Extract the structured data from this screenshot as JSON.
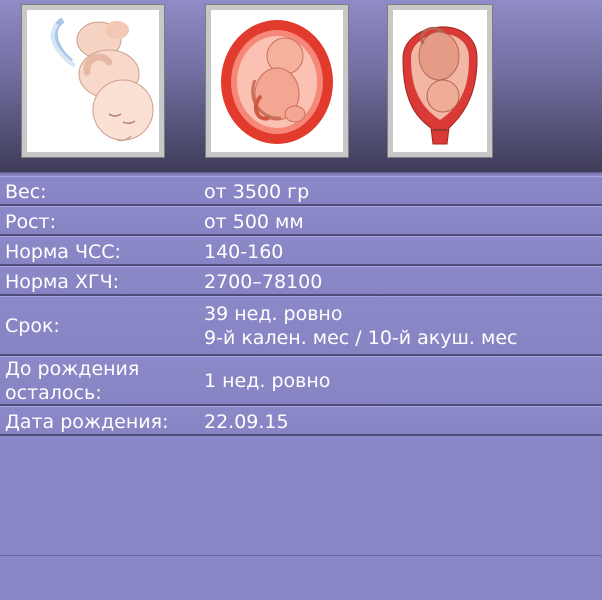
{
  "header": {
    "images": [
      {
        "name": "fetus-illustration-1",
        "alt": "fetus-head-down-illustration"
      },
      {
        "name": "fetus-illustration-2",
        "alt": "fetus-in-womb-illustration"
      },
      {
        "name": "fetus-illustration-3",
        "alt": "fetus-uterus-cross-section-illustration"
      }
    ]
  },
  "info": {
    "weight": {
      "label": "Вес:",
      "value": "от 3500 гр"
    },
    "height": {
      "label": "Рост:",
      "value": "от 500 мм"
    },
    "heart_rate": {
      "label": "Норма ЧСС:",
      "value": "140-160"
    },
    "hcg": {
      "label": "Норма ХГЧ:",
      "value": "2700–78100"
    },
    "term": {
      "label": "Срок:",
      "value_line1": "39 нед. ровно",
      "value_line2": "9-й кален. мес / 10-й акуш. мес"
    },
    "remaining": {
      "label_line1": "До рождения",
      "label_line2": "осталось:",
      "value": "1 нед. ровно"
    },
    "birth_date": {
      "label": "Дата рождения:",
      "value": "22.09.15"
    }
  },
  "colors": {
    "background": "#8a87c6",
    "row_border": "#4f4d78",
    "text": "#ffffff"
  }
}
